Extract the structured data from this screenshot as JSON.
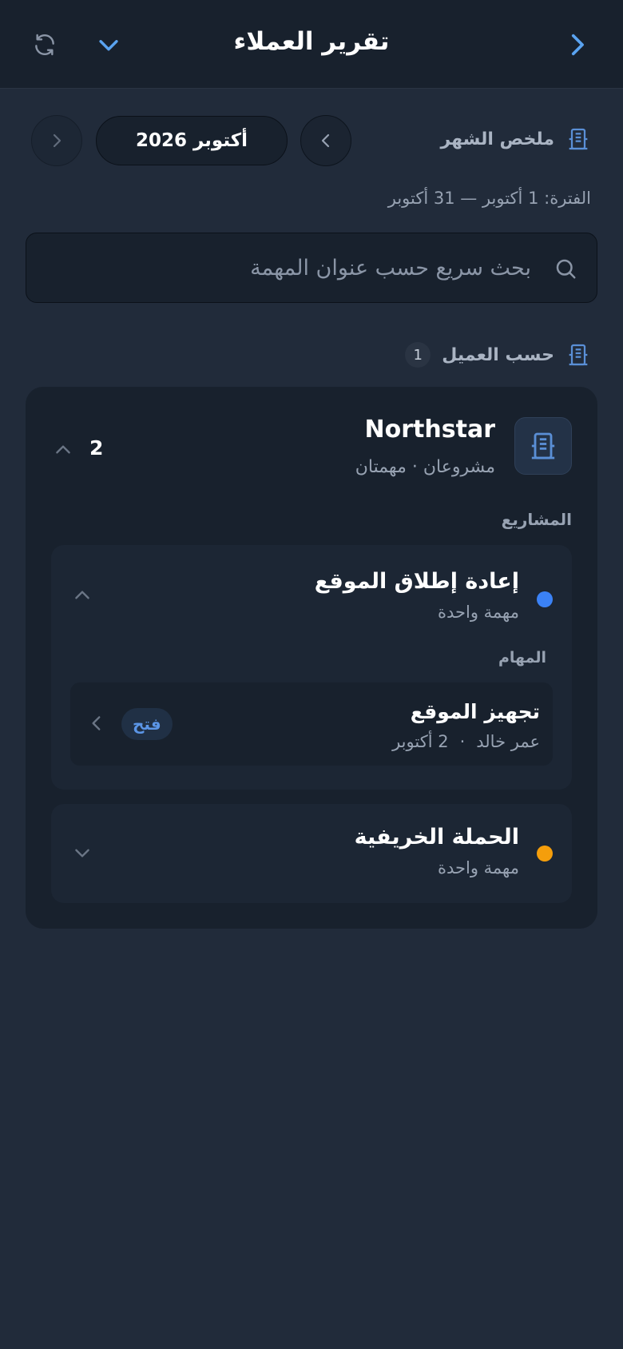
{
  "header": {
    "title": "تقرير العملاء"
  },
  "month": {
    "section_label": "ملخص الشهر",
    "current": "أكتوبر 2026",
    "period": "الفترة: 1 أكتوبر — 31 أكتوبر"
  },
  "search": {
    "placeholder": "بحث سريع حسب عنوان المهمة",
    "value": ""
  },
  "by_client": {
    "label": "حسب العميل",
    "count": "1"
  },
  "client": {
    "name": "Northstar",
    "meta": "مشروعان · مهمتان",
    "count": "2",
    "projects_label": "المشاريع",
    "projects": [
      {
        "title": "إعادة إطلاق الموقع",
        "subtitle": "مهمة واحدة",
        "color": "#3b82f6",
        "tasks_label": "المهام",
        "tasks": [
          {
            "title": "تجهيز الموقع",
            "assignee": "عمر خالد",
            "separator": "·",
            "date": "2 أكتوبر",
            "status": "فتح"
          }
        ]
      },
      {
        "title": "الحملة الخريفية",
        "subtitle": "مهمة واحدة",
        "color": "#f59e0b"
      }
    ]
  },
  "icons": {
    "back": "chevron-right-icon",
    "collapse": "chevron-down-icon",
    "refresh": "refresh-icon",
    "building": "building-icon",
    "search": "search-icon"
  }
}
